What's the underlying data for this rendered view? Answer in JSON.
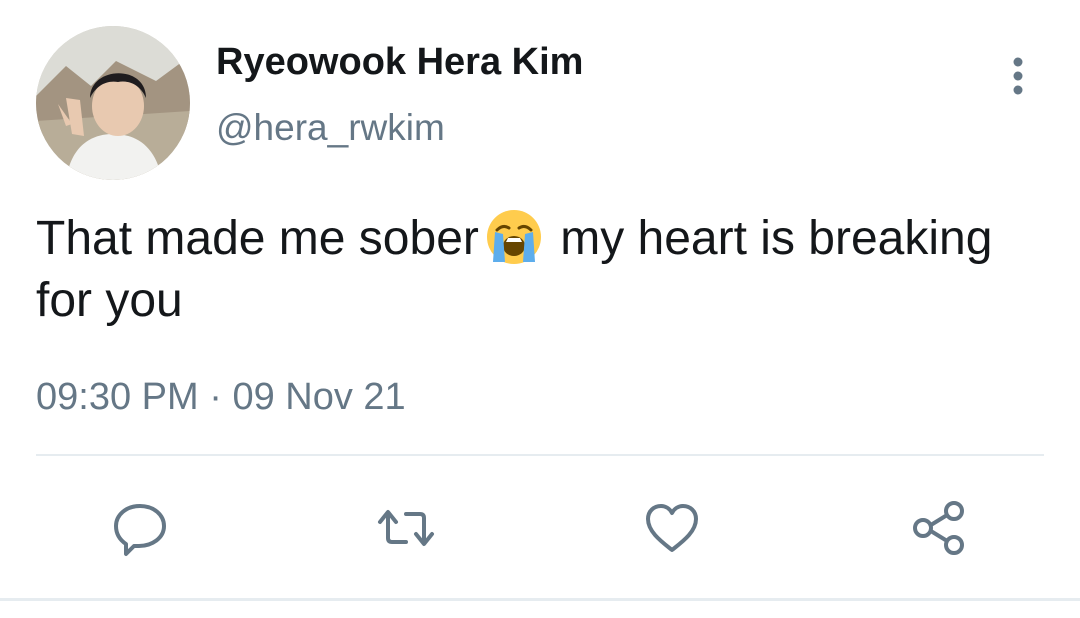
{
  "user": {
    "display_name": "Ryeowook Hera Kim",
    "handle": "@hera_rwkim",
    "avatar": "profile-photo"
  },
  "tweet": {
    "text_before_emoji": "That made me sober",
    "emoji": "loudly-crying-face",
    "text_after_emoji": " my heart is breaking for you",
    "time": "09:30 PM",
    "separator": " · ",
    "date": "09 Nov 21"
  },
  "actions": {
    "reply_icon": "speech-bubble-icon",
    "retweet_icon": "retweet-icon",
    "like_icon": "heart-icon",
    "share_icon": "share-icon",
    "more_icon": "vertical-ellipsis-icon"
  },
  "colors": {
    "text_primary": "#14171a",
    "text_secondary": "#657786",
    "icon": "#657786",
    "divider": "#e6ecf0"
  }
}
